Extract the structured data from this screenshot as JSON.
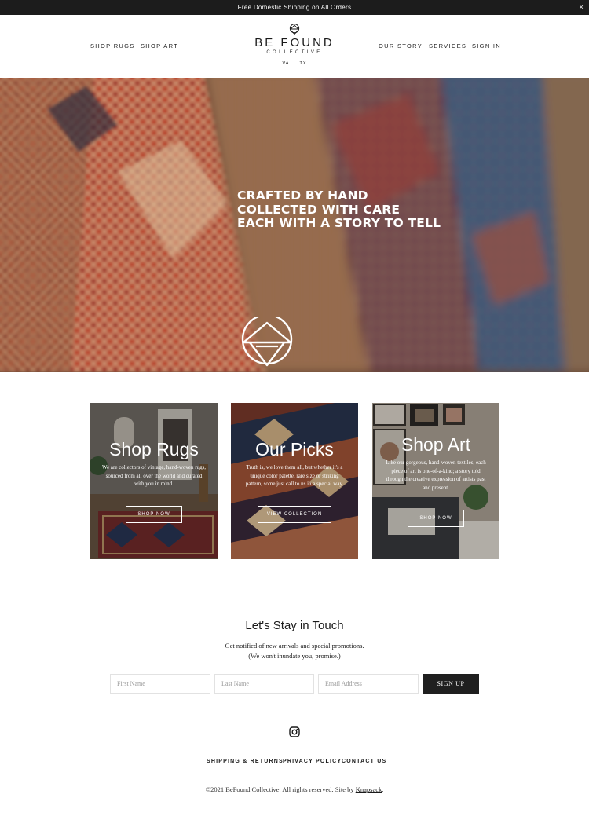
{
  "announcement": {
    "text": "Free Domestic Shipping on All Orders",
    "close": "×"
  },
  "nav": {
    "shop_rugs": "SHOP RUGS",
    "shop_art": "SHOP ART",
    "our_story": "OUR STORY",
    "services": "SERVICES",
    "sign_in": "SIGN IN"
  },
  "logo": {
    "name": "BE FOUND",
    "sub": "COLLECTIVE",
    "loc_left": "VA",
    "loc_right": "TX"
  },
  "hero": {
    "line1": "CRAFTED BY HAND",
    "line2": "COLLECTED WITH CARE",
    "line3": "EACH WITH A STORY TO TELL"
  },
  "cards": [
    {
      "title": "Shop Rugs",
      "description": "We are collectors of vintage, hand-woven rugs, sourced from all over the world and curated with you in mind.",
      "button": "SHOP NOW"
    },
    {
      "title": "Our Picks",
      "description": "Truth is, we love them all, but whether it's a unique color palette, rare size or striking pattern, some just call to us in a special way.",
      "button": "VIEW COLLECTION"
    },
    {
      "title": "Shop Art",
      "description": "Like our gorgeous, hand-woven textiles, each piece of art is one-of-a-kind; a story told through the creative expression of artists past and present.",
      "button": "SHOP NOW"
    }
  ],
  "newsletter": {
    "title": "Let's Stay in Touch",
    "line1": "Get notified of new arrivals and special promotions.",
    "line2": "(We won't inundate you, promise.)",
    "first_name_placeholder": "First Name",
    "last_name_placeholder": "Last Name",
    "email_placeholder": "Email Address",
    "button": "SIGN UP"
  },
  "social": {
    "icon": "instagram-icon"
  },
  "footer": {
    "shipping": "SHIPPING & RETURNS",
    "privacy": "PRIVACY POLICY",
    "contact": "CONTACT US",
    "copyright": "©2021 BeFound Collective. All rights reserved. Site by",
    "credit": "Knapsack",
    "period": "."
  },
  "colors": {
    "announcement_bg": "#1c1c1c",
    "signup_bg": "#1f1f1f",
    "accent_rug": "#c8442a"
  }
}
